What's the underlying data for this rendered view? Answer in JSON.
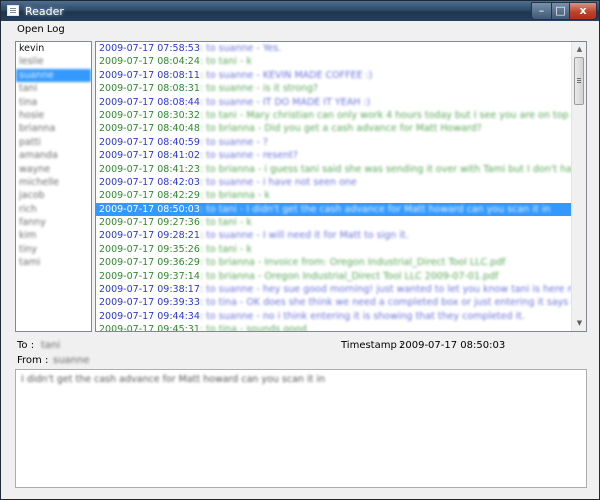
{
  "window": {
    "title": "Reader",
    "minimize": "–",
    "maximize": "□",
    "close": "x"
  },
  "menu": {
    "open_log": "Open Log"
  },
  "users": [
    {
      "name": "kevin",
      "selected": false
    },
    {
      "name": "leslie",
      "selected": false
    },
    {
      "name": "suanne",
      "selected": true
    },
    {
      "name": "tani",
      "selected": false
    },
    {
      "name": "tina",
      "selected": false
    },
    {
      "name": "hosie",
      "selected": false
    },
    {
      "name": "brianna",
      "selected": false
    },
    {
      "name": "patti",
      "selected": false
    },
    {
      "name": "amanda",
      "selected": false
    },
    {
      "name": "wayne",
      "selected": false
    },
    {
      "name": "michelle",
      "selected": false
    },
    {
      "name": "jacob",
      "selected": false
    },
    {
      "name": "rich",
      "selected": false
    },
    {
      "name": "fanny",
      "selected": false
    },
    {
      "name": "kim",
      "selected": false
    },
    {
      "name": "tiny",
      "selected": false
    },
    {
      "name": "tami",
      "selected": false
    }
  ],
  "log": [
    {
      "time": "2009-07-17 07:58:53",
      "text": " : to suanne - Yes.",
      "color": "blue"
    },
    {
      "time": "2009-07-17 08:04:24",
      "text": " : to tani - k",
      "color": "green"
    },
    {
      "time": "2009-07-17 08:08:11",
      "text": " : to suanne - KEVIN MADE COFFEE :)",
      "color": "blue"
    },
    {
      "time": "2009-07-17 08:08:31",
      "text": " : to suanne - is it strong?",
      "color": "green"
    },
    {
      "time": "2009-07-17 08:08:44",
      "text": " : to suanne - IT DO MADE IT YEAH :)",
      "color": "blue"
    },
    {
      "time": "2009-07-17 08:30:32",
      "text": " : to tani - Mary christian can only work 4 hours today but I see you are on top of t",
      "color": "green"
    },
    {
      "time": "2009-07-17 08:40:48",
      "text": " : to brianna - Did you get a cash advance for Matt Howard?",
      "color": "green"
    },
    {
      "time": "2009-07-17 08:40:59",
      "text": " : to suanne - ?",
      "color": "blue"
    },
    {
      "time": "2009-07-17 08:41:02",
      "text": " : to suanne - resent?",
      "color": "blue"
    },
    {
      "time": "2009-07-17 08:41:23",
      "text": " : to brianna - i guess tani said she was sending it over with Tami but I don't have i",
      "color": "green"
    },
    {
      "time": "2009-07-17 08:42:03",
      "text": " : to suanne - i have not seen one",
      "color": "blue"
    },
    {
      "time": "2009-07-17 08:42:29",
      "text": " : to brianna - k",
      "color": "green"
    },
    {
      "time": "2009-07-17 08:50:03",
      "text": " : to tani - I didn't get the cash advance for Matt howard can you scan it in",
      "color": "blue",
      "selected": true
    },
    {
      "time": "2009-07-17 09:27:36",
      "text": " : to tani - k",
      "color": "green"
    },
    {
      "time": "2009-07-17 09:28:21",
      "text": " : to suanne - I will need it for Matt to sign it.",
      "color": "blue"
    },
    {
      "time": "2009-07-17 09:35:26",
      "text": " : to tani - k",
      "color": "green"
    },
    {
      "time": "2009-07-17 09:36:29",
      "text": " : to brianna - Invoice from: Oregon Industrial_Direct Tool LLC.pdf",
      "color": "green"
    },
    {
      "time": "2009-07-17 09:37:14",
      "text": " : to brianna - Oregon Industrial_Direct Tool LLC 2009-07-01.pdf",
      "color": "green"
    },
    {
      "time": "2009-07-17 09:38:17",
      "text": " : to suanne - hey sue good morning! just wanted to let you know tani is here now",
      "color": "blue"
    },
    {
      "time": "2009-07-17 09:39:33",
      "text": " : to tina - OK  does she think we need a completed box or just entering it says it is",
      "color": "blue"
    },
    {
      "time": "2009-07-17 09:44:34",
      "text": " : to suanne - no i think entering it is showing that they completed it.",
      "color": "blue"
    },
    {
      "time": "2009-07-17 09:45:31",
      "text": " : to tina - sounds good",
      "color": "green"
    }
  ],
  "details": {
    "to_label": "To :",
    "to_value": "tani",
    "timestamp_label": "Timestamp :",
    "timestamp_value": "2009-07-17 08:50:03",
    "from_label": "From :",
    "from_value": "suanne",
    "message": "I didn't get the cash advance for Matt howard can you scan it in"
  },
  "colors": {
    "selection": "#3399ff",
    "timestamp_blue": "#2a38d0",
    "timestamp_green": "#2f8a2f"
  }
}
